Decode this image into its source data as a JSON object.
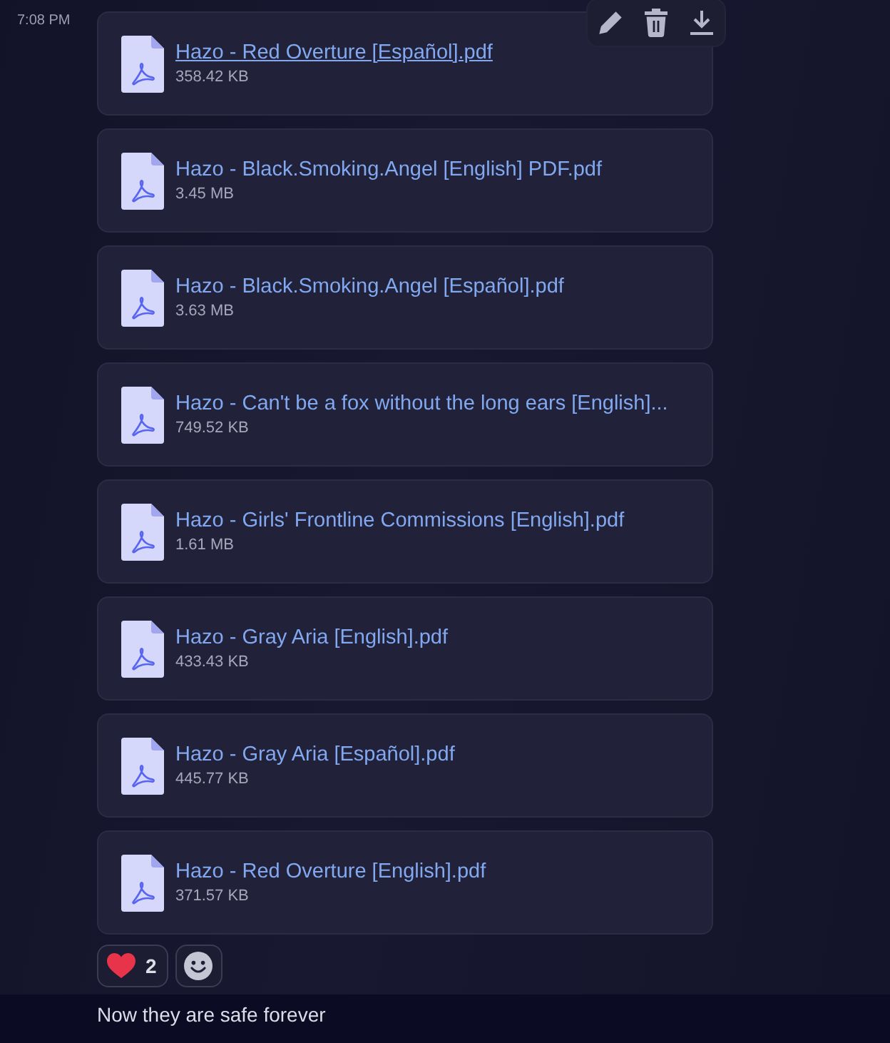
{
  "timestamp": "7:08 PM",
  "attachments": [
    {
      "name": "Hazo - Red Overture [Español].pdf",
      "size": "358.42 KB",
      "hovered": true
    },
    {
      "name": "Hazo - Black.Smoking.Angel [English] PDF.pdf",
      "size": "3.45 MB",
      "hovered": false
    },
    {
      "name": "Hazo - Black.Smoking.Angel [Español].pdf",
      "size": "3.63 MB",
      "hovered": false
    },
    {
      "name": "Hazo - Can't be a fox without the long ears [English]...",
      "size": "749.52 KB",
      "hovered": false
    },
    {
      "name": "Hazo - Girls' Frontline Commissions [English].pdf",
      "size": "1.61 MB",
      "hovered": false
    },
    {
      "name": "Hazo - Gray Aria [English].pdf",
      "size": "433.43 KB",
      "hovered": false
    },
    {
      "name": "Hazo - Gray Aria [Español].pdf",
      "size": "445.77 KB",
      "hovered": false
    },
    {
      "name": "Hazo - Red Overture [English].pdf",
      "size": "371.57 KB",
      "hovered": false
    }
  ],
  "reactions": [
    {
      "count": "2"
    }
  ],
  "next_message": {
    "text": "Now they are safe forever"
  }
}
